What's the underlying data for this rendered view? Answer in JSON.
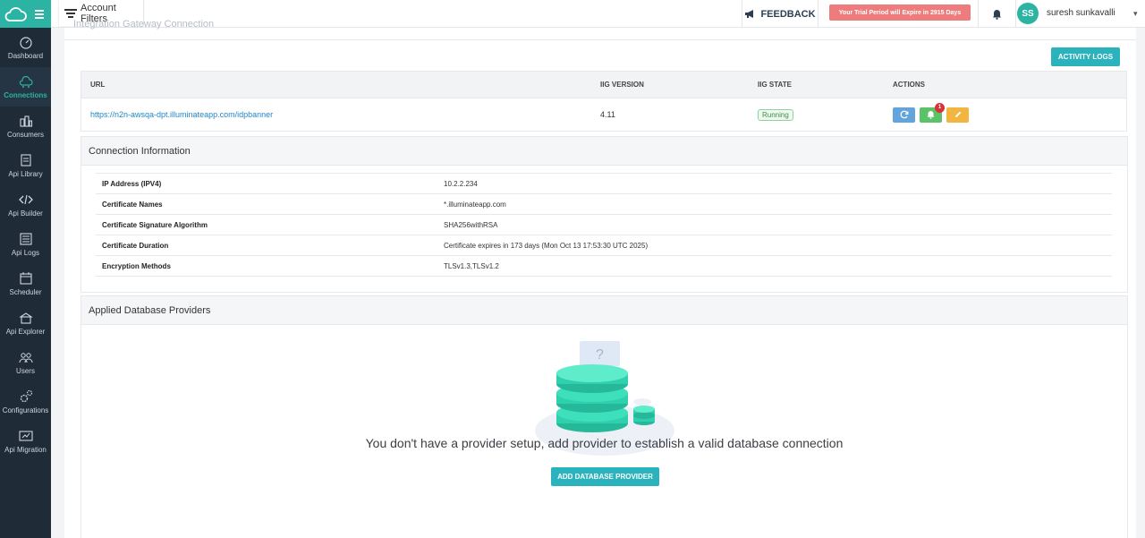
{
  "sidebar": {
    "items": [
      {
        "label": "Dashboard",
        "icon": "dashboard-icon"
      },
      {
        "label": "Connections",
        "icon": "connections-icon",
        "active": true
      },
      {
        "label": "Consumers",
        "icon": "consumers-icon"
      },
      {
        "label": "Api Library",
        "icon": "api-library-icon"
      },
      {
        "label": "Api Builder",
        "icon": "api-builder-icon"
      },
      {
        "label": "Api Logs",
        "icon": "api-logs-icon"
      },
      {
        "label": "Scheduler",
        "icon": "scheduler-icon"
      },
      {
        "label": "Api Explorer",
        "icon": "api-explorer-icon"
      },
      {
        "label": "Users",
        "icon": "users-icon"
      },
      {
        "label": "Configurations",
        "icon": "configurations-icon"
      },
      {
        "label": "Api Migration",
        "icon": "api-migration-icon"
      }
    ]
  },
  "header": {
    "account_filters": "Account Filters",
    "feedback": "FEEDBACK",
    "trial": "Your Trial Period will Expire in 2915 Days",
    "avatar_initials": "SS",
    "username": "suresh sunkavalli"
  },
  "main": {
    "cut_title": "Integration Gateway Connection",
    "activity_logs": "ACTIVITY LOGS",
    "table": {
      "headers": {
        "url": "URL",
        "version": "IIG VERSION",
        "state": "IIG STATE",
        "actions": "ACTIONS"
      },
      "row": {
        "url": "https://n2n-awsqa-dpt.illuminateapp.com/idpbanner",
        "version": "4.11",
        "state": "Running",
        "badge": "1"
      }
    },
    "connection_info": {
      "title": "Connection Information",
      "rows": [
        {
          "key": "IP Address (IPV4)",
          "value": "10.2.2.234"
        },
        {
          "key": "Certificate Names",
          "value": "*.illuminateapp.com"
        },
        {
          "key": "Certificate Signature Algorithm",
          "value": "SHA256withRSA"
        },
        {
          "key": "Certificate Duration",
          "value": "Certificate expires in 173 days (Mon Oct 13 17:53:30 UTC 2025)"
        },
        {
          "key": "Encryption Methods",
          "value": "TLSv1.3,TLSv1.2"
        }
      ]
    },
    "providers": {
      "title": "Applied Database Providers",
      "empty_message": "You don't have a provider setup, add provider to establish a valid database connection",
      "add_button": "ADD DATABASE PROVIDER",
      "question_mark": "?"
    }
  },
  "colors": {
    "accent": "#2bb3bd",
    "sidebar": "#1f2b37",
    "trial": "#ef7c7c",
    "running": "#3d8b48"
  }
}
